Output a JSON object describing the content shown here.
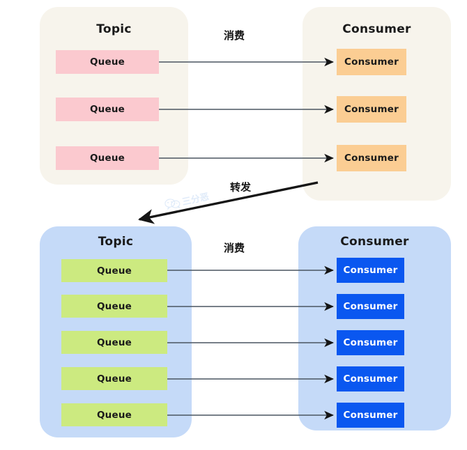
{
  "diagram": {
    "title_topic": "Topic",
    "title_consumer": "Consumer",
    "label_queue": "Queue",
    "label_consumer": "Consumer",
    "label_consume_cn": "消费",
    "label_forward_cn": "转发",
    "watermark_text": "三分恶",
    "colors": {
      "panel_cream": "#f7f4ec",
      "panel_blue": "#c5daf8",
      "queue_pink": "#fbc9cf",
      "queue_green": "#ccea80",
      "consumer_orange": "#fbcd93",
      "consumer_blue": "#0a57f0",
      "arrow": "#151515",
      "connector": "#4a5560",
      "watermark": "#c8dcf5"
    },
    "groups": [
      {
        "id": "top",
        "topic_title": "Topic",
        "consumer_title": "Consumer",
        "consume_label": "消费",
        "queues": [
          {
            "label": "Queue"
          },
          {
            "label": "Queue"
          },
          {
            "label": "Queue"
          }
        ],
        "consumers": [
          {
            "label": "Consumer"
          },
          {
            "label": "Consumer"
          },
          {
            "label": "Consumer"
          }
        ]
      },
      {
        "id": "bottom",
        "topic_title": "Topic",
        "consumer_title": "Consumer",
        "consume_label": "消费",
        "queues": [
          {
            "label": "Queue"
          },
          {
            "label": "Queue"
          },
          {
            "label": "Queue"
          },
          {
            "label": "Queue"
          },
          {
            "label": "Queue"
          }
        ],
        "consumers": [
          {
            "label": "Consumer"
          },
          {
            "label": "Consumer"
          },
          {
            "label": "Consumer"
          },
          {
            "label": "Consumer"
          },
          {
            "label": "Consumer"
          }
        ]
      }
    ]
  }
}
